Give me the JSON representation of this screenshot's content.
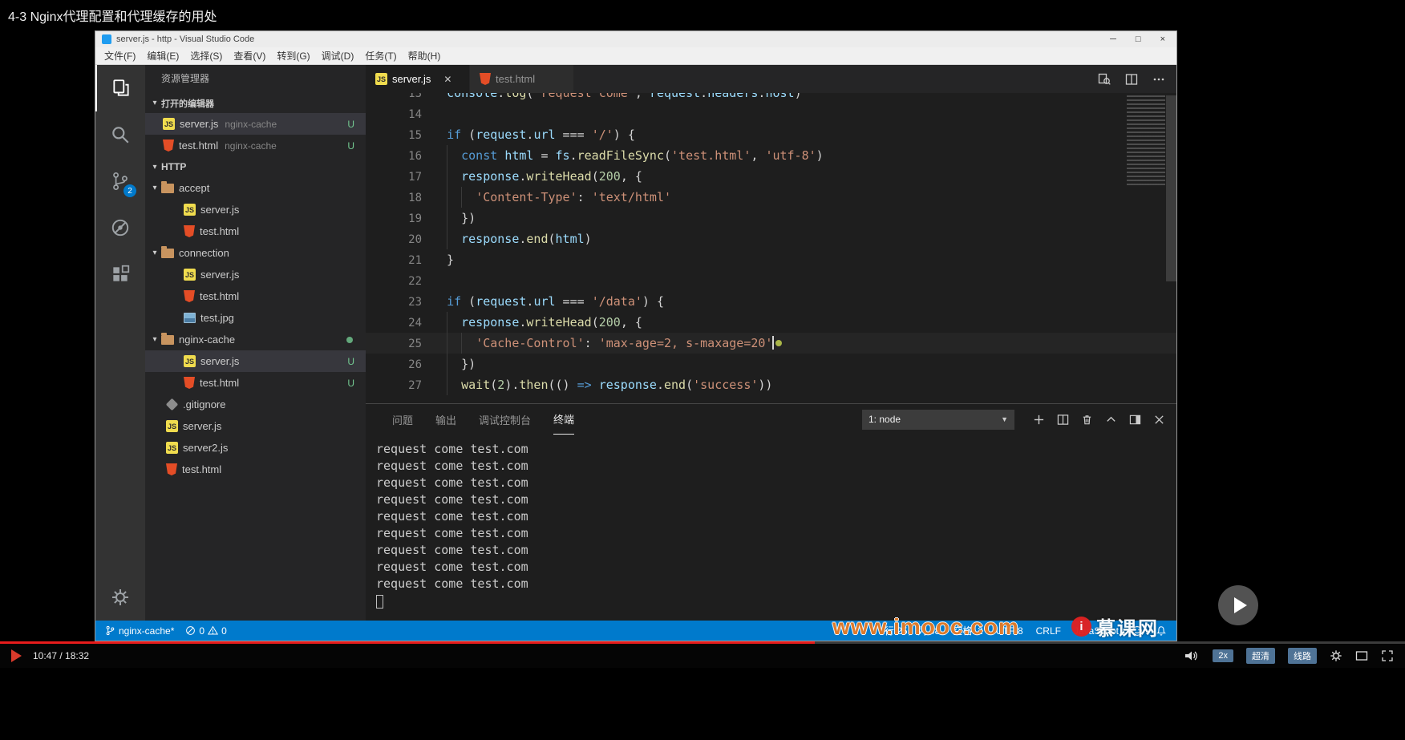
{
  "player": {
    "video_title": "4-3 Nginx代理配置和代理缓存的用处",
    "current_time": "10:47",
    "duration": "18:32",
    "time_display": "10:47 / 18:32",
    "progress_percent": 58,
    "speed": "2x",
    "quality": "超清",
    "line": "线路",
    "watermark_url": "www.imooc.com",
    "brand": "慕课网"
  },
  "vscode": {
    "window_title": "server.js - http - Visual Studio Code",
    "window_controls": {
      "minimize": "─",
      "maximize": "□",
      "close": "×"
    },
    "menus": [
      "文件(F)",
      "编辑(E)",
      "选择(S)",
      "查看(V)",
      "转到(G)",
      "调试(D)",
      "任务(T)",
      "帮助(H)"
    ],
    "activity": {
      "source_control_badge": "2"
    },
    "sidebar": {
      "title": "资源管理器",
      "open_editors_label": "打开的编辑器",
      "open_editors": [
        {
          "icon": "js",
          "name": "server.js",
          "detail": "nginx-cache",
          "badge": "U",
          "selected": true
        },
        {
          "icon": "html",
          "name": "test.html",
          "detail": "nginx-cache",
          "badge": "U",
          "selected": false
        }
      ],
      "workspace_label": "HTTP",
      "tree": [
        {
          "type": "folder",
          "name": "accept"
        },
        {
          "type": "file",
          "icon": "js",
          "name": "server.js",
          "child": true
        },
        {
          "type": "file",
          "icon": "html",
          "name": "test.html",
          "child": true
        },
        {
          "type": "folder",
          "name": "connection"
        },
        {
          "type": "file",
          "icon": "js",
          "name": "server.js",
          "child": true
        },
        {
          "type": "file",
          "icon": "html",
          "name": "test.html",
          "child": true
        },
        {
          "type": "file",
          "icon": "img",
          "name": "test.jpg",
          "child": true
        },
        {
          "type": "folder",
          "name": "nginx-cache",
          "dot": true
        },
        {
          "type": "file",
          "icon": "js",
          "name": "server.js",
          "child": true,
          "badge": "U",
          "selected": true
        },
        {
          "type": "file",
          "icon": "html",
          "name": "test.html",
          "child": true,
          "badge": "U"
        },
        {
          "type": "file",
          "icon": "git",
          "name": ".gitignore"
        },
        {
          "type": "file",
          "icon": "js",
          "name": "server.js"
        },
        {
          "type": "file",
          "icon": "js",
          "name": "server2.js"
        },
        {
          "type": "file",
          "icon": "html",
          "name": "test.html"
        }
      ]
    },
    "tabs": [
      {
        "icon": "js",
        "name": "server.js",
        "active": true
      },
      {
        "icon": "html",
        "name": "test.html",
        "active": false
      }
    ],
    "code_lines": [
      {
        "num": "13",
        "segs": [
          [
            "p",
            "  "
          ],
          [
            "v",
            "console"
          ],
          [
            "p",
            "."
          ],
          [
            "f",
            "log"
          ],
          [
            "p",
            "("
          ],
          [
            "s",
            "'request come'"
          ],
          [
            "p",
            ", "
          ],
          [
            "v",
            "request"
          ],
          [
            "p",
            "."
          ],
          [
            "v",
            "headers"
          ],
          [
            "p",
            "."
          ],
          [
            "v",
            "host"
          ],
          [
            "p",
            ")"
          ]
        ]
      },
      {
        "num": "14",
        "segs": []
      },
      {
        "num": "15",
        "segs": [
          [
            "p",
            "  "
          ],
          [
            "k",
            "if"
          ],
          [
            "p",
            " ("
          ],
          [
            "v",
            "request"
          ],
          [
            "p",
            "."
          ],
          [
            "v",
            "url"
          ],
          [
            "p",
            " === "
          ],
          [
            "s",
            "'/'"
          ],
          [
            "p",
            ") {"
          ]
        ]
      },
      {
        "num": "16",
        "segs": [
          [
            "p",
            "    "
          ],
          [
            "k",
            "const"
          ],
          [
            "p",
            " "
          ],
          [
            "v",
            "html"
          ],
          [
            "p",
            " = "
          ],
          [
            "v",
            "fs"
          ],
          [
            "p",
            "."
          ],
          [
            "f",
            "readFileSync"
          ],
          [
            "p",
            "("
          ],
          [
            "s",
            "'test.html'"
          ],
          [
            "p",
            ", "
          ],
          [
            "s",
            "'utf-8'"
          ],
          [
            "p",
            ")"
          ]
        ]
      },
      {
        "num": "17",
        "segs": [
          [
            "p",
            "    "
          ],
          [
            "v",
            "response"
          ],
          [
            "p",
            "."
          ],
          [
            "f",
            "writeHead"
          ],
          [
            "p",
            "("
          ],
          [
            "n",
            "200"
          ],
          [
            "p",
            ", {"
          ]
        ]
      },
      {
        "num": "18",
        "segs": [
          [
            "p",
            "      "
          ],
          [
            "s",
            "'Content-Type'"
          ],
          [
            "p",
            ": "
          ],
          [
            "s",
            "'text/html'"
          ]
        ]
      },
      {
        "num": "19",
        "segs": [
          [
            "p",
            "    })"
          ]
        ]
      },
      {
        "num": "20",
        "segs": [
          [
            "p",
            "    "
          ],
          [
            "v",
            "response"
          ],
          [
            "p",
            "."
          ],
          [
            "f",
            "end"
          ],
          [
            "p",
            "("
          ],
          [
            "v",
            "html"
          ],
          [
            "p",
            ")"
          ]
        ]
      },
      {
        "num": "21",
        "segs": [
          [
            "p",
            "  }"
          ]
        ]
      },
      {
        "num": "22",
        "segs": []
      },
      {
        "num": "23",
        "segs": [
          [
            "p",
            "  "
          ],
          [
            "k",
            "if"
          ],
          [
            "p",
            " ("
          ],
          [
            "v",
            "request"
          ],
          [
            "p",
            "."
          ],
          [
            "v",
            "url"
          ],
          [
            "p",
            " === "
          ],
          [
            "s",
            "'/data'"
          ],
          [
            "p",
            ") {"
          ]
        ]
      },
      {
        "num": "24",
        "segs": [
          [
            "p",
            "    "
          ],
          [
            "v",
            "response"
          ],
          [
            "p",
            "."
          ],
          [
            "f",
            "writeHead"
          ],
          [
            "p",
            "("
          ],
          [
            "n",
            "200"
          ],
          [
            "p",
            ", {"
          ]
        ]
      },
      {
        "num": "25",
        "caret": true,
        "cur": true,
        "segs": [
          [
            "p",
            "      "
          ],
          [
            "s",
            "'Cache-Control'"
          ],
          [
            "p",
            ": "
          ],
          [
            "s",
            "'max-age=2, s-maxage=20'"
          ]
        ]
      },
      {
        "num": "26",
        "segs": [
          [
            "p",
            "    })"
          ]
        ]
      },
      {
        "num": "27",
        "segs": [
          [
            "p",
            "    "
          ],
          [
            "f",
            "wait"
          ],
          [
            "p",
            "("
          ],
          [
            "n",
            "2"
          ],
          [
            "p",
            ")."
          ],
          [
            "f",
            "then"
          ],
          [
            "p",
            "(() "
          ],
          [
            "k",
            "=>"
          ],
          [
            "p",
            " "
          ],
          [
            "v",
            "response"
          ],
          [
            "p",
            "."
          ],
          [
            "f",
            "end"
          ],
          [
            "p",
            "("
          ],
          [
            "s",
            "'success'"
          ],
          [
            "p",
            "))"
          ]
        ]
      }
    ],
    "panel": {
      "tabs": [
        {
          "label": "问题",
          "active": false
        },
        {
          "label": "输出",
          "active": false
        },
        {
          "label": "调试控制台",
          "active": false
        },
        {
          "label": "终端",
          "active": true
        }
      ],
      "terminal_select": "1: node",
      "terminal_lines": [
        "request come test.com",
        "request come test.com",
        "request come test.com",
        "request come test.com",
        "request come test.com",
        "request come test.com",
        "request come test.com",
        "request come test.com",
        "request come test.com"
      ]
    },
    "status": {
      "branch": "nginx-cache*",
      "errors": "0",
      "warnings": "0",
      "right_items": [
        "行 25，列 48",
        "空格: 2",
        "UTF-8",
        "CRLF",
        "JavaScript"
      ]
    }
  }
}
